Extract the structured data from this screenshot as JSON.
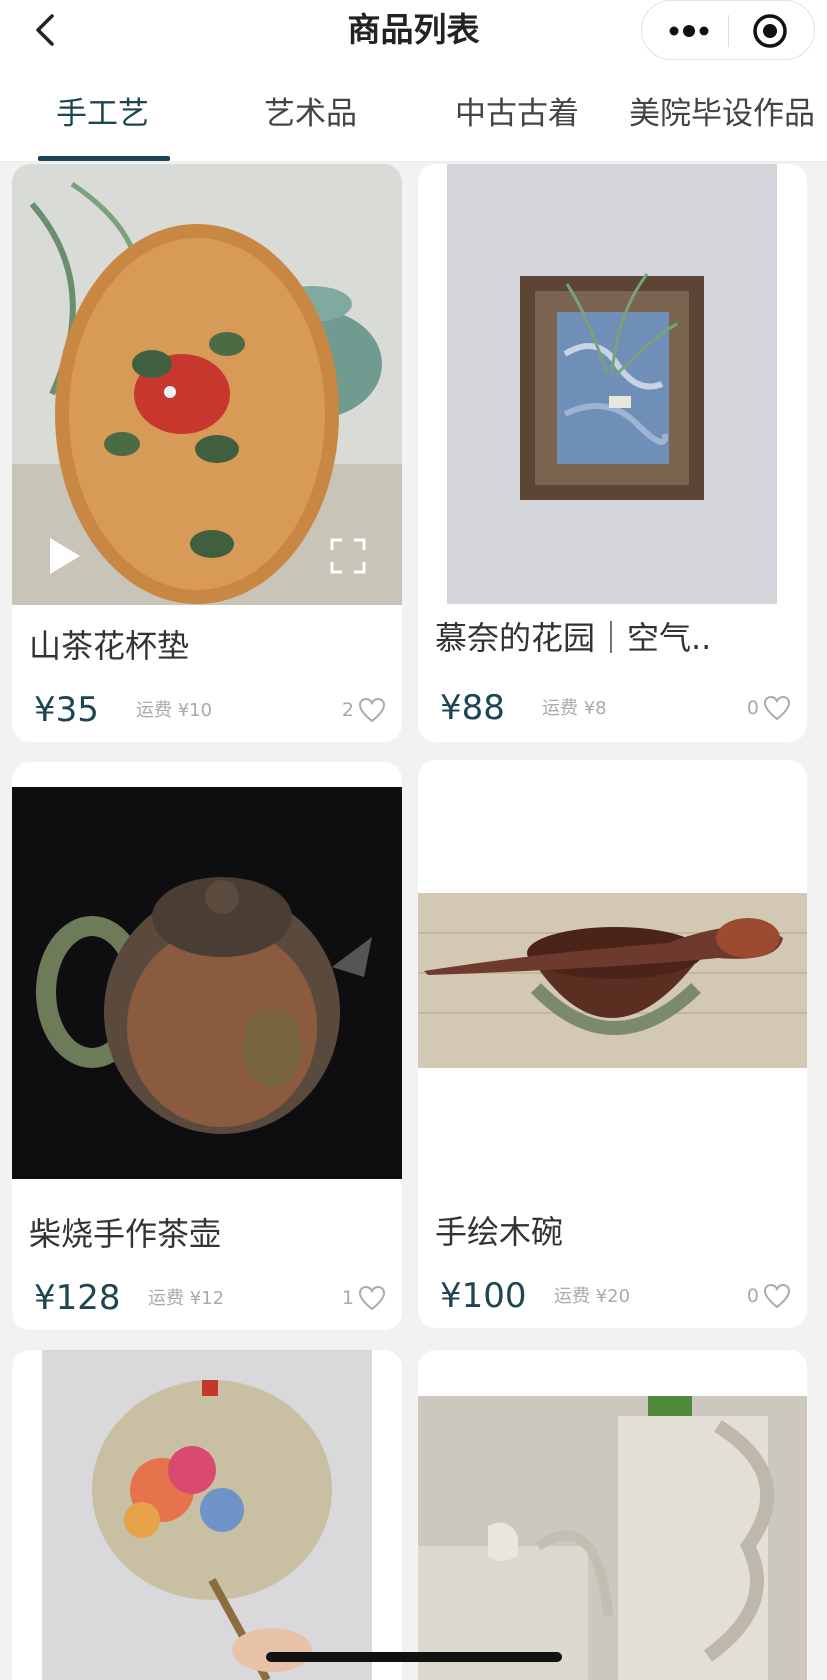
{
  "header": {
    "title": "商品列表",
    "back_icon": "chevron-left-icon",
    "more_icon": "more-dots-icon",
    "target_icon": "target-icon"
  },
  "tabs": [
    {
      "label": "手工艺",
      "active": true
    },
    {
      "label": "艺术品",
      "active": false
    },
    {
      "label": "中古古着",
      "active": false
    },
    {
      "label": "美院毕设作品",
      "active": false
    }
  ],
  "products": [
    {
      "name": "山茶花杯垫",
      "price": "¥35",
      "shipping": "运费 ¥10",
      "likes": "2"
    },
    {
      "name": "慕奈的花园｜空气..",
      "price": "¥88",
      "shipping": "运费 ¥8",
      "likes": "0"
    },
    {
      "name": "柴烧手作茶壶",
      "price": "¥128",
      "shipping": "运费 ¥12",
      "likes": "1"
    },
    {
      "name": "手绘木碗",
      "price": "¥100",
      "shipping": "运费 ¥20",
      "likes": "0"
    }
  ],
  "colors": {
    "accent": "#1d4552",
    "background": "#f2f2f2",
    "muted": "#aaaaaa"
  }
}
